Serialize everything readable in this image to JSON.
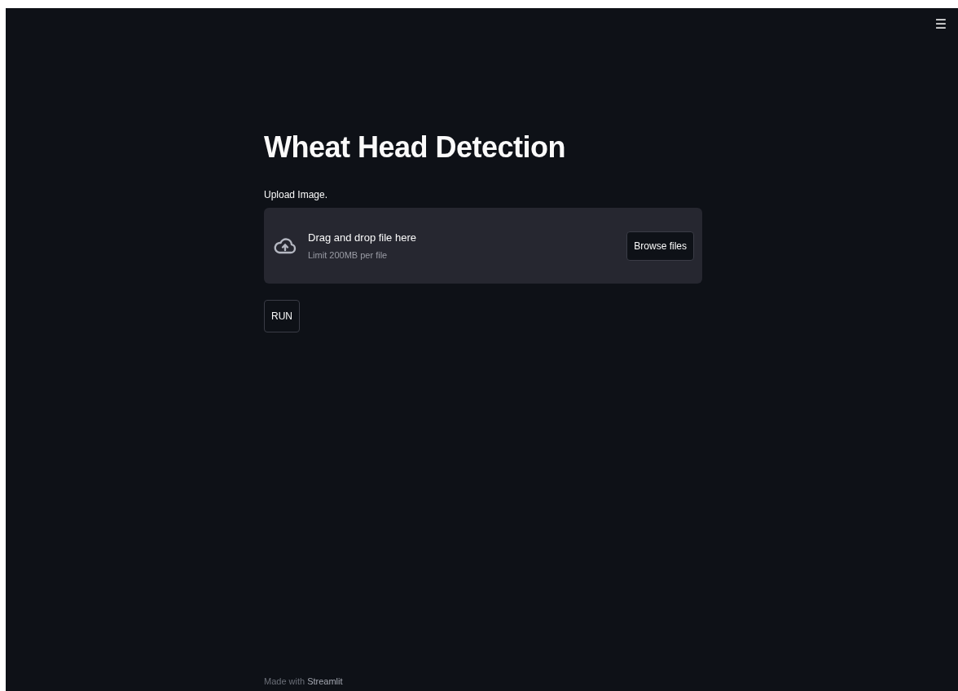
{
  "menu": {
    "icon": "☰"
  },
  "title": "Wheat Head Detection",
  "uploader": {
    "label": "Upload Image.",
    "instruction": "Drag and drop file here",
    "limit": "Limit 200MB per file",
    "button": "Browse files"
  },
  "run_button": "RUN",
  "footer": {
    "prefix": "Made with",
    "brand": "Streamlit"
  }
}
